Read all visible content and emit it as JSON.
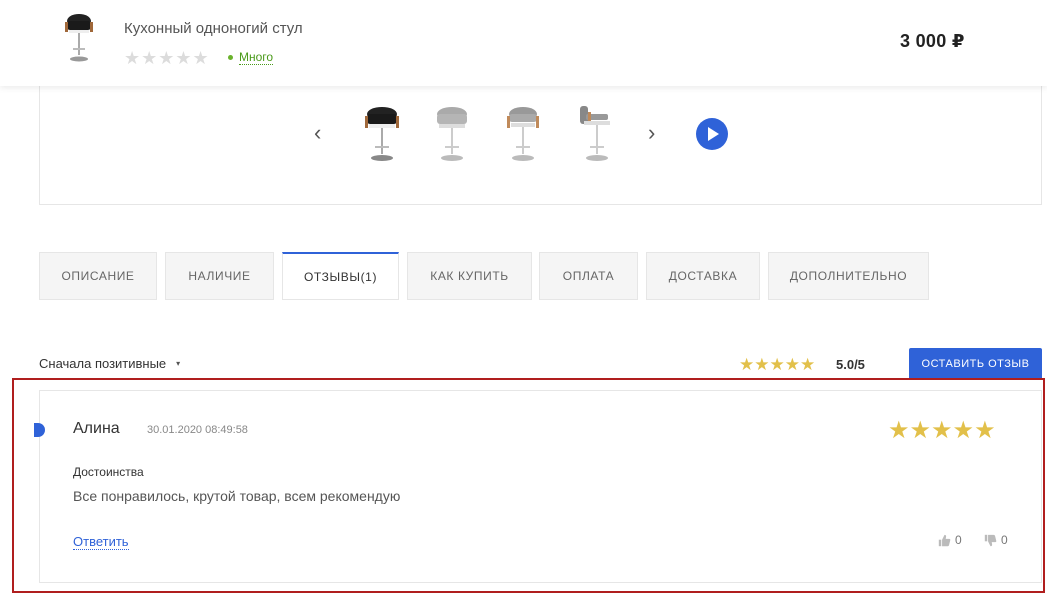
{
  "header": {
    "product_title": "Кухонный одноногий стул",
    "rating_stars": "★★★★★",
    "stock_label": "Много",
    "price": "3 000 ₽"
  },
  "gallery": {
    "prev_icon": "chevron-left-icon",
    "next_icon": "chevron-right-icon",
    "prev_glyph": "‹",
    "next_glyph": "›",
    "play_icon": "play-icon"
  },
  "tabs": [
    {
      "label": "ОПИСАНИЕ"
    },
    {
      "label": "НАЛИЧИЕ"
    },
    {
      "label": "ОТЗЫВЫ(1)"
    },
    {
      "label": "КАК КУПИТЬ"
    },
    {
      "label": "ОПЛАТА"
    },
    {
      "label": "ДОСТАВКА"
    },
    {
      "label": "ДОПОЛНИТЕЛЬНО"
    }
  ],
  "reviews_toolbar": {
    "sort_label": "Сначала позитивные",
    "caret": "▾",
    "summary_stars": "★★★★★",
    "summary_score": "5.0/5",
    "leave_review": "ОСТАВИТЬ ОТЗЫВ"
  },
  "review": {
    "author": "Алина",
    "date": "30.01.2020 08:49:58",
    "stars": "★★★★★",
    "pros_heading": "Достоинства",
    "pros_text": "Все понравилось, крутой товар, всем рекомендую",
    "reply": "Ответить",
    "likes": "0",
    "dislikes": "0"
  },
  "colors": {
    "accent": "#2f62d8",
    "star": "#e2c04a",
    "stock": "#4a9a1a",
    "highlight": "#b01e1e"
  }
}
